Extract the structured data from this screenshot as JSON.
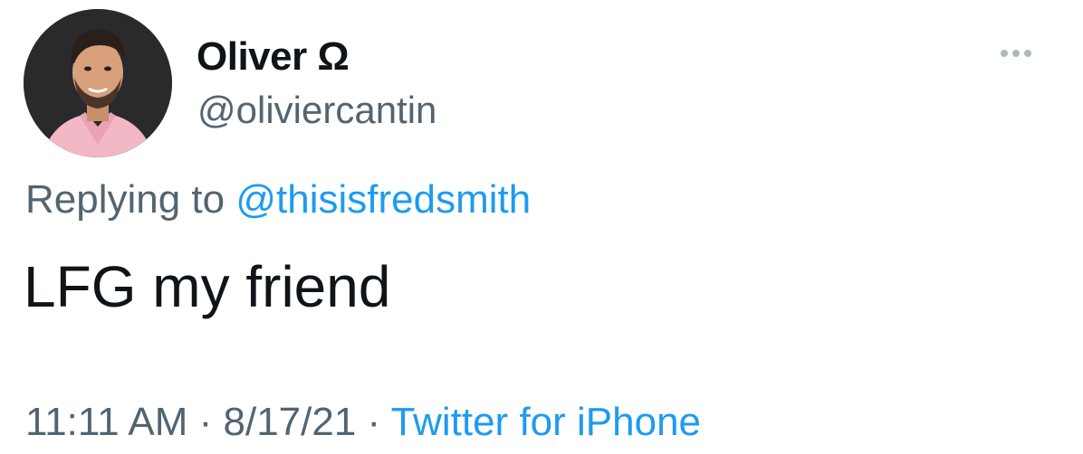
{
  "tweet": {
    "author": {
      "display_name": "Oliver Ω",
      "handle": "@oliviercantin"
    },
    "reply": {
      "prefix": "Replying to",
      "mention": "@thisisfredsmith"
    },
    "text": "LFG my friend",
    "meta": {
      "time": "11:11 AM",
      "separator1": "·",
      "date": "8/17/21",
      "separator2": "·",
      "source": "Twitter for iPhone"
    },
    "icons": {
      "more": "more-options-icon"
    },
    "colors": {
      "link": "#1d9bf0",
      "secondary": "#536471",
      "primary": "#0f1419"
    }
  }
}
